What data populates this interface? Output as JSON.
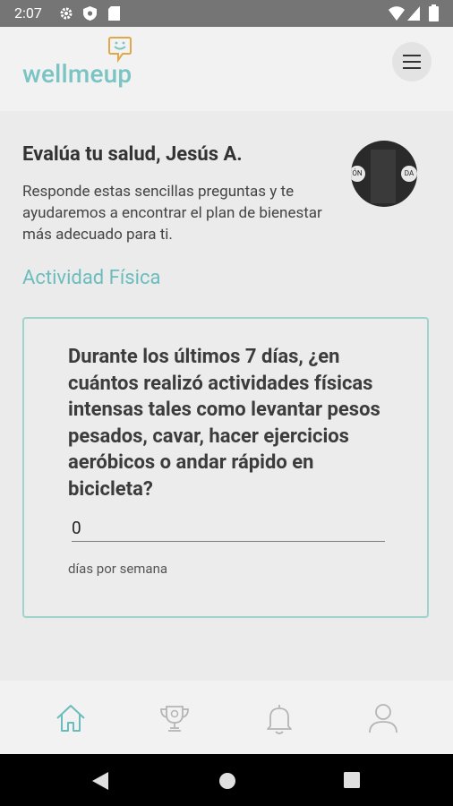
{
  "status_bar": {
    "time": "2:07"
  },
  "app": {
    "logo_text": "wellmeup"
  },
  "greeting": "Evalúa tu salud, Jesús A.",
  "intro": "Responde estas sencillas preguntas y te ayudaremos a encontrar el plan de bienestar más adecuado para ti.",
  "avatar_text": {
    "left": "ÓN",
    "right": "DA"
  },
  "section_title": "Actividad Física",
  "question": {
    "text": "Durante los últimos 7 días, ¿en cuántos realizó actividades físicas intensas tales como levantar pesos pesados, cavar, hacer ejercicios aeróbicos o andar rápido en bicicleta?",
    "value": "0",
    "unit": "días por semana"
  },
  "colors": {
    "accent": "#6bbdbd",
    "card_border": "#9fd4cc"
  },
  "bottom_nav": [
    "home-icon",
    "trophy-icon",
    "bell-icon",
    "user-icon"
  ]
}
